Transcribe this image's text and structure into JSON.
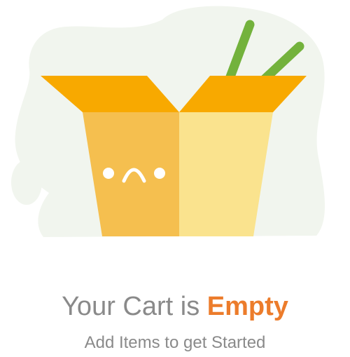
{
  "empty_state": {
    "title_prefix": "Your Cart is ",
    "title_highlight": "Empty",
    "subtitle": "Add Items to get Started"
  },
  "illustration": {
    "icon": "empty-takeout-box-icon",
    "mood": "sad-face",
    "colors": {
      "backdrop": "#f1f5ee",
      "box_left": "#f5bf4f",
      "box_right": "#fae38e",
      "box_flaps": "#f8a900",
      "chopsticks": "#73b23c",
      "face": "#ffffff"
    }
  },
  "colors": {
    "text": "#8a8a8a",
    "accent": "#ec7c2b"
  }
}
